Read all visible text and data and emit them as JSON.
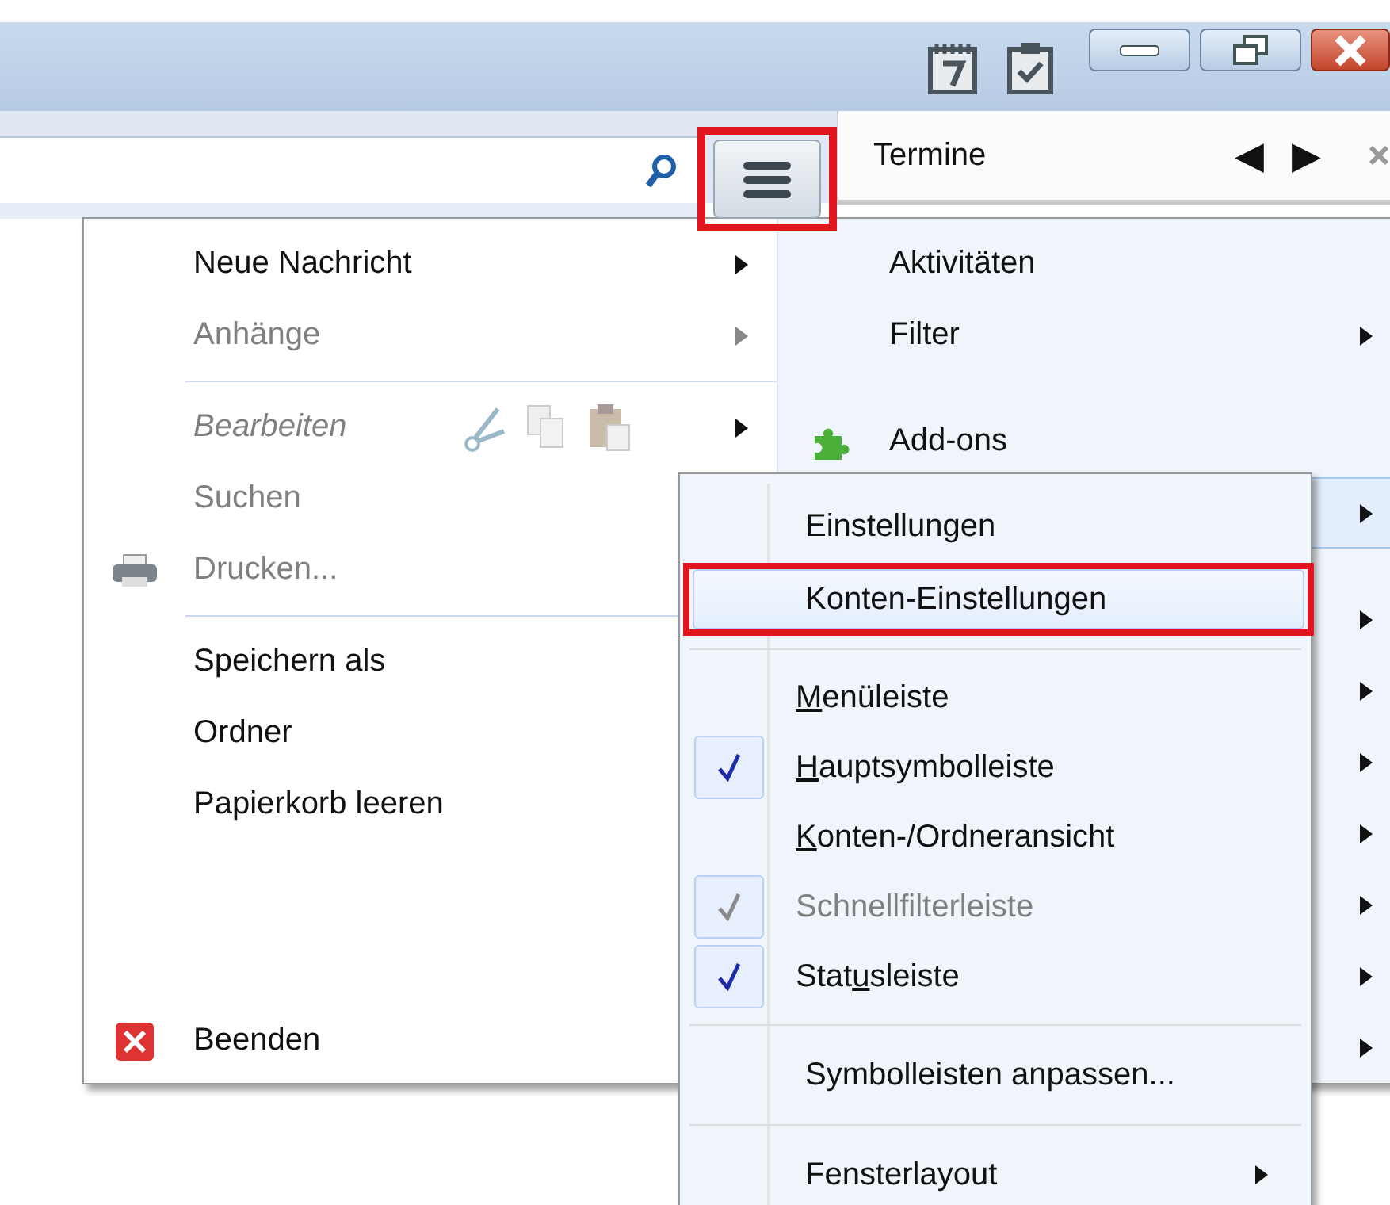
{
  "title_bar": {
    "buttons": [
      {
        "kind": "minimize"
      },
      {
        "kind": "restore"
      },
      {
        "kind": "close"
      }
    ]
  },
  "toolbar": {
    "menu_button": {
      "annotated": true
    },
    "pane": {
      "title": "Termine",
      "prev": "◀",
      "next": "▶"
    }
  },
  "app_menu": {
    "left": [
      {
        "kind": "item",
        "label": "Neue Nachricht",
        "disabled": false,
        "submenu": true
      },
      {
        "kind": "item",
        "label": "Anhänge",
        "disabled": true,
        "submenu": true
      },
      {
        "kind": "separator"
      },
      {
        "kind": "edit",
        "label": "Bearbeiten",
        "disabled": true,
        "submenu": true
      },
      {
        "kind": "item",
        "label": "Suchen",
        "disabled": true,
        "submenu": false
      },
      {
        "kind": "print",
        "label": "Drucken...",
        "disabled": true,
        "submenu": false
      },
      {
        "kind": "separator"
      },
      {
        "kind": "item",
        "label": "Speichern als",
        "disabled": false
      },
      {
        "kind": "item",
        "label": "Ordner",
        "disabled": false
      },
      {
        "kind": "item",
        "label": "Papierkorb leeren",
        "disabled": false
      },
      {
        "kind": "exit",
        "label": "Beenden",
        "disabled": false
      }
    ],
    "right": [
      {
        "kind": "item",
        "label": "Aktivitäten",
        "submenu": false,
        "highlighted": false
      },
      {
        "kind": "item",
        "label": "Filter",
        "submenu": true,
        "highlighted": false
      },
      {
        "kind": "separator"
      },
      {
        "kind": "addons",
        "label": "Add-ons",
        "submenu": false,
        "highlighted": false
      },
      {
        "kind": "item",
        "submenu": true,
        "highlighted": true
      },
      {
        "kind": "separator"
      },
      {
        "kind": "item",
        "submenu": true,
        "highlighted": false
      },
      {
        "kind": "item",
        "submenu": true,
        "highlighted": false
      },
      {
        "kind": "item",
        "submenu": true,
        "highlighted": false
      },
      {
        "kind": "item",
        "submenu": true,
        "highlighted": false
      },
      {
        "kind": "item",
        "submenu": true,
        "highlighted": false
      },
      {
        "kind": "item",
        "submenu": true,
        "highlighted": false
      },
      {
        "kind": "item",
        "submenu": true,
        "highlighted": false
      }
    ]
  },
  "submenu": [
    {
      "kind": "item",
      "label": "Einstellungen",
      "highlighted": false,
      "annotated": false,
      "submenu": false
    },
    {
      "kind": "item",
      "label": "Konten-Einstellungen",
      "highlighted": true,
      "annotated": true,
      "submenu": false
    },
    {
      "kind": "separator"
    },
    {
      "kind": "check",
      "key": "M",
      "post": "enüleiste",
      "checked": false,
      "disabled": false
    },
    {
      "kind": "check",
      "key": "H",
      "post": "auptsymbolleiste",
      "checked": true,
      "disabled": false
    },
    {
      "kind": "check",
      "key": "K",
      "post": "onten-/Ordneransicht",
      "checked": false,
      "disabled": false
    },
    {
      "kind": "check",
      "label": "Schnellfilterleiste",
      "checked": true,
      "disabled": true
    },
    {
      "kind": "check",
      "pre": "Stat",
      "key": "u",
      "post": "sleiste",
      "checked": true,
      "disabled": false
    },
    {
      "kind": "separator"
    },
    {
      "kind": "item",
      "label": "Symbolleisten anpassen...",
      "highlighted": false,
      "annotated": false,
      "submenu": false
    },
    {
      "kind": "separator"
    },
    {
      "kind": "item",
      "label": "Fensterlayout",
      "highlighted": false,
      "annotated": false,
      "submenu": true
    }
  ]
}
